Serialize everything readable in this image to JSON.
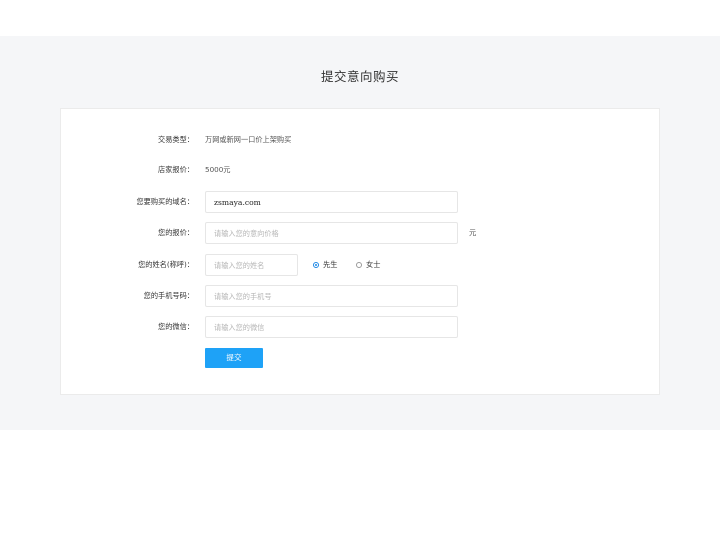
{
  "page": {
    "title": "提交意向购买"
  },
  "form": {
    "trade_type": {
      "label": "交易类型：",
      "value": "万网或新网一口价上架购买"
    },
    "store_price": {
      "label": "店家报价：",
      "value": "5000元"
    },
    "domain": {
      "label": "您要购买的域名：",
      "value": "zsmaya.com"
    },
    "offer": {
      "label": "您的报价：",
      "placeholder": "请输入您的意向价格",
      "value": "",
      "unit": "元"
    },
    "name": {
      "label": "您的姓名(称呼)：",
      "placeholder": "请输入您的姓名",
      "value": "",
      "gender_options": [
        {
          "label": "先生",
          "checked": true
        },
        {
          "label": "女士",
          "checked": false
        }
      ]
    },
    "phone": {
      "label": "您的手机号码：",
      "placeholder": "请输入您的手机号",
      "value": ""
    },
    "wechat": {
      "label": "您的微信：",
      "placeholder": "请输入您的微信",
      "value": ""
    },
    "submit_label": "提交"
  },
  "colors": {
    "background_band": "#f5f6f8",
    "primary": "#1ea2f7",
    "radio_checked": "#1e88e5"
  }
}
